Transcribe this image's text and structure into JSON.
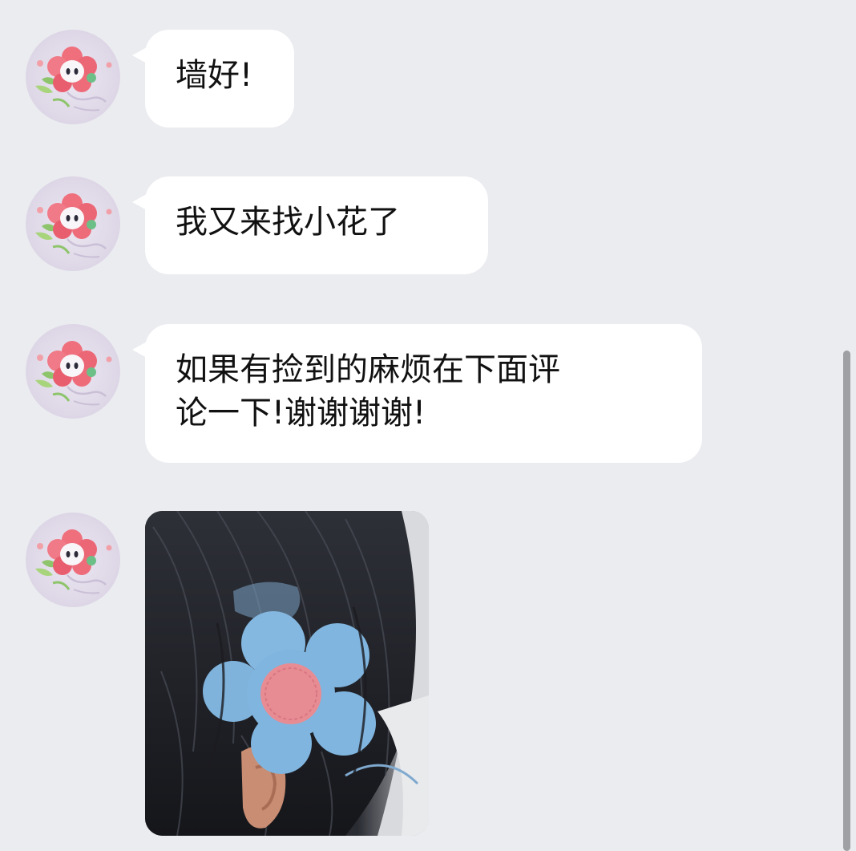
{
  "messages": [
    {
      "sender_avatar": "flower-avatar",
      "type": "text",
      "text": "墙好!"
    },
    {
      "sender_avatar": "flower-avatar",
      "type": "text",
      "text": "我又来找小花了"
    },
    {
      "sender_avatar": "flower-avatar",
      "type": "text",
      "text": "如果有捡到的麻烦在下面评\n论一下!谢谢谢谢!"
    },
    {
      "sender_avatar": "flower-avatar",
      "type": "image",
      "image": "photo-blue-flower-hair-clip"
    }
  ],
  "colors": {
    "background": "#ebecf0",
    "bubble": "#ffffff",
    "text": "#111111",
    "scrollbar": "#9fa0a4"
  }
}
